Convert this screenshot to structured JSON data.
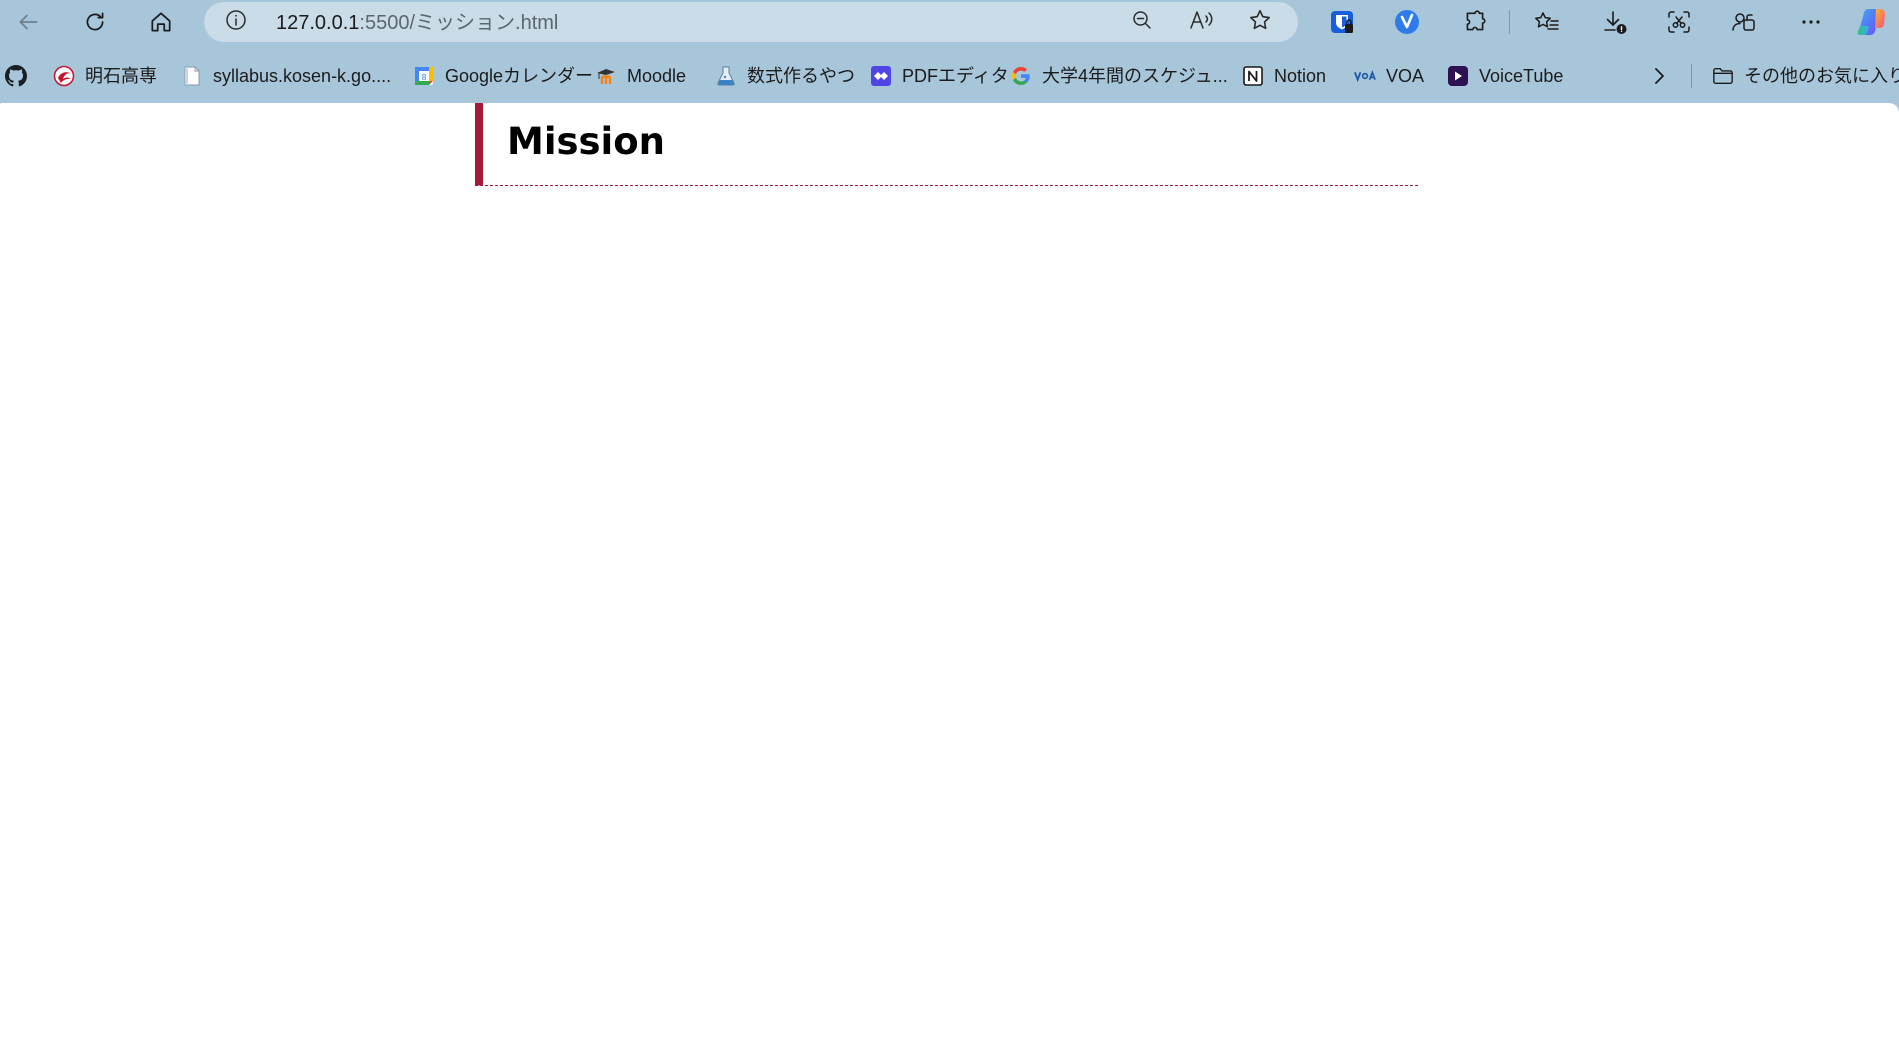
{
  "browser": {
    "address": {
      "host": "127.0.0.1",
      "path": ":5500/ミッション.html"
    },
    "toolbar_icons": [
      "back-arrow-icon",
      "refresh-icon",
      "home-icon",
      "site-info-icon",
      "zoom-out-icon",
      "read-aloud-icon",
      "favorite-star-icon",
      "bitwarden-icon",
      "extension-v-icon",
      "extensions-puzzle-icon",
      "favorites-list-icon",
      "downloads-icon",
      "screenshot-icon",
      "profile-share-icon",
      "more-menu-icon",
      "copilot-icon"
    ]
  },
  "bookmarks": {
    "items": [
      {
        "label": "",
        "icon": "github-icon"
      },
      {
        "label": "明石高専",
        "icon": "akashi-kosen-icon"
      },
      {
        "label": "syllabus.kosen-k.go....",
        "icon": "page-icon"
      },
      {
        "label": "Googleカレンダー",
        "icon": "google-calendar-icon"
      },
      {
        "label": "Moodle",
        "icon": "moodle-icon"
      },
      {
        "label": "数式作るやつ",
        "icon": "flask-icon"
      },
      {
        "label": "PDFエディタ",
        "icon": "pdf-editor-icon"
      },
      {
        "label": "大学4年間のスケジュ...",
        "icon": "google-icon"
      },
      {
        "label": "Notion",
        "icon": "notion-icon"
      },
      {
        "label": "VOA",
        "icon": "voa-icon"
      },
      {
        "label": "VoiceTube",
        "icon": "voicetube-icon"
      }
    ],
    "other_favorites": "その他のお気に入り"
  },
  "page": {
    "heading": "Mission"
  },
  "colors": {
    "chrome_background": "#a8c6da",
    "address_bar": "#c9dce8",
    "heading_accent": "#a31a3a"
  }
}
